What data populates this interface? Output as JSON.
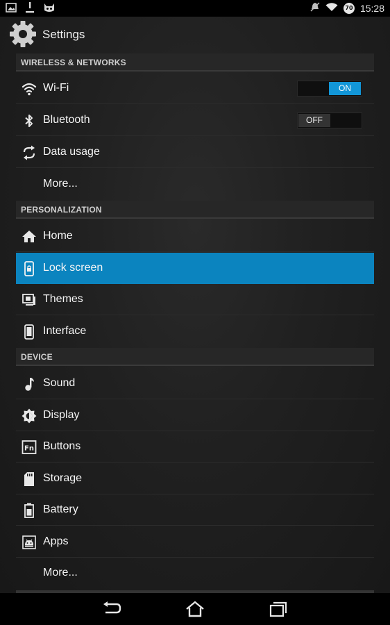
{
  "status_bar": {
    "time": "15:28",
    "battery_level": "70",
    "left_icons": [
      "image-notification-icon",
      "download-icon",
      "android-cat-icon"
    ],
    "right_icons": [
      "notifications-muted-icon",
      "wifi-signal-icon",
      "battery-icon"
    ]
  },
  "app_bar": {
    "title": "Settings",
    "icon": "gear-icon"
  },
  "sections": {
    "wireless": {
      "header": "WIRELESS & NETWORKS",
      "items": [
        {
          "label": "Wi-Fi",
          "icon": "wifi-icon",
          "toggle": "ON"
        },
        {
          "label": "Bluetooth",
          "icon": "bluetooth-icon",
          "toggle": "OFF"
        },
        {
          "label": "Data usage",
          "icon": "data-usage-icon"
        },
        {
          "label": "More..."
        }
      ]
    },
    "personalization": {
      "header": "PERSONALIZATION",
      "items": [
        {
          "label": "Home",
          "icon": "home-icon"
        },
        {
          "label": "Lock screen",
          "icon": "lock-screen-icon",
          "selected": true
        },
        {
          "label": "Themes",
          "icon": "themes-icon"
        },
        {
          "label": "Interface",
          "icon": "interface-icon"
        }
      ]
    },
    "device": {
      "header": "DEVICE",
      "items": [
        {
          "label": "Sound",
          "icon": "music-note-icon"
        },
        {
          "label": "Display",
          "icon": "display-brightness-icon"
        },
        {
          "label": "Buttons",
          "icon": "fn-buttons-icon"
        },
        {
          "label": "Storage",
          "icon": "sd-card-icon"
        },
        {
          "label": "Battery",
          "icon": "battery-icon"
        },
        {
          "label": "Apps",
          "icon": "android-apps-icon"
        },
        {
          "label": "More..."
        }
      ]
    }
  },
  "colors": {
    "accent": "#0b84bf",
    "toggle_on": "#1296d8",
    "background": "#1e1e1e"
  },
  "nav_bar": {
    "buttons": [
      "back-icon",
      "home-icon",
      "recent-apps-icon"
    ]
  }
}
